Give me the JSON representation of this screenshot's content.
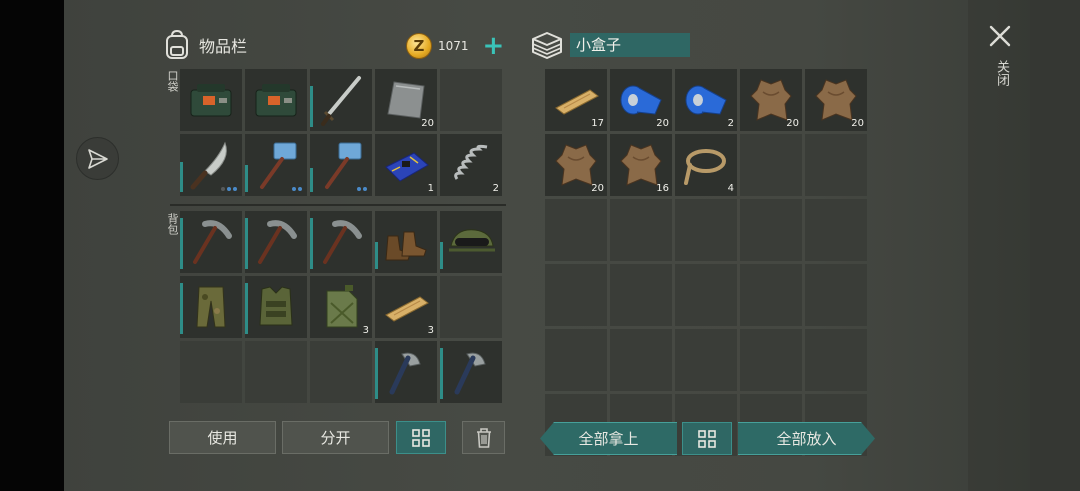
{
  "inventory": {
    "title": "物品栏",
    "coins": "1071",
    "coin_symbol": "Z",
    "pocket_label": "口袋",
    "backpack_label": "背包",
    "pocket_slots": [
      {
        "item": "toolbox-icon",
        "qty": "",
        "bar": 0,
        "dots": 0
      },
      {
        "item": "toolbox-icon",
        "qty": "",
        "bar": 0,
        "dots": 0
      },
      {
        "item": "sword-icon",
        "qty": "",
        "bar": 0.75,
        "dots": 0
      },
      {
        "item": "metal-plate-icon",
        "qty": "20",
        "bar": 0,
        "dots": 0
      },
      {
        "item": "",
        "qty": "",
        "bar": 0,
        "dots": 0
      },
      {
        "item": "machete-icon",
        "qty": "",
        "bar": 0.55,
        "dots": 3
      },
      {
        "item": "sledgehammer-icon",
        "qty": "",
        "bar": 0.5,
        "dots": 2
      },
      {
        "item": "sledgehammer-icon",
        "qty": "",
        "bar": 0.45,
        "dots": 2
      },
      {
        "item": "circuit-board-icon",
        "qty": "1",
        "bar": 0,
        "dots": 0
      },
      {
        "item": "spring-icon",
        "qty": "2",
        "bar": 0,
        "dots": 0
      }
    ],
    "backpack_slots": [
      {
        "item": "pickaxe-icon",
        "qty": "",
        "bar": 0.95,
        "dots": 0
      },
      {
        "item": "pickaxe-icon",
        "qty": "",
        "bar": 0.95,
        "dots": 0
      },
      {
        "item": "pickaxe-icon",
        "qty": "",
        "bar": 0.95,
        "dots": 0
      },
      {
        "item": "boots-icon",
        "qty": "",
        "bar": 0.5,
        "dots": 0
      },
      {
        "item": "cap-goggles-icon",
        "qty": "",
        "bar": 0.5,
        "dots": 0
      },
      {
        "item": "camo-pants-icon",
        "qty": "",
        "bar": 0.95,
        "dots": 0
      },
      {
        "item": "camo-vest-icon",
        "qty": "",
        "bar": 0.95,
        "dots": 0
      },
      {
        "item": "jerrycan-icon",
        "qty": "3",
        "bar": 0,
        "dots": 0
      },
      {
        "item": "wood-plank-icon",
        "qty": "3",
        "bar": 0,
        "dots": 0
      },
      {
        "item": "",
        "qty": "",
        "bar": 0,
        "dots": 0
      },
      {
        "item": "",
        "qty": "",
        "bar": 0,
        "dots": 0
      },
      {
        "item": "",
        "qty": "",
        "bar": 0,
        "dots": 0
      },
      {
        "item": "",
        "qty": "",
        "bar": 0,
        "dots": 0
      },
      {
        "item": "hatchet-icon",
        "qty": "",
        "bar": 0.95,
        "dots": 0
      },
      {
        "item": "hatchet-icon",
        "qty": "",
        "bar": 0.95,
        "dots": 0
      }
    ],
    "use_label": "使用",
    "split_label": "分开"
  },
  "container": {
    "title": "小盒子",
    "slots": [
      {
        "item": "wood-plank-icon",
        "qty": "17"
      },
      {
        "item": "blue-tape-icon",
        "qty": "20"
      },
      {
        "item": "blue-tape-icon",
        "qty": "2"
      },
      {
        "item": "leather-icon",
        "qty": "20"
      },
      {
        "item": "leather-icon",
        "qty": "20"
      },
      {
        "item": "leather-icon",
        "qty": "20"
      },
      {
        "item": "leather-icon",
        "qty": "16"
      },
      {
        "item": "rope-icon",
        "qty": "4"
      },
      {
        "item": "",
        "qty": ""
      },
      {
        "item": "",
        "qty": ""
      },
      {
        "item": "",
        "qty": ""
      },
      {
        "item": "",
        "qty": ""
      },
      {
        "item": "",
        "qty": ""
      },
      {
        "item": "",
        "qty": ""
      },
      {
        "item": "",
        "qty": ""
      },
      {
        "item": "",
        "qty": ""
      },
      {
        "item": "",
        "qty": ""
      },
      {
        "item": "",
        "qty": ""
      },
      {
        "item": "",
        "qty": ""
      },
      {
        "item": "",
        "qty": ""
      },
      {
        "item": "",
        "qty": ""
      },
      {
        "item": "",
        "qty": ""
      },
      {
        "item": "",
        "qty": ""
      },
      {
        "item": "",
        "qty": ""
      },
      {
        "item": "",
        "qty": ""
      },
      {
        "item": "",
        "qty": ""
      },
      {
        "item": "",
        "qty": ""
      },
      {
        "item": "",
        "qty": ""
      },
      {
        "item": "",
        "qty": ""
      },
      {
        "item": "",
        "qty": ""
      }
    ],
    "take_all_label": "全部拿上",
    "put_all_label": "全部放入"
  },
  "close_label": "关闭",
  "colors": {
    "accent": "#2f6764",
    "accent_bright": "#3ac3b8",
    "slot": "#2e312d",
    "bar": "#2e8d88"
  }
}
